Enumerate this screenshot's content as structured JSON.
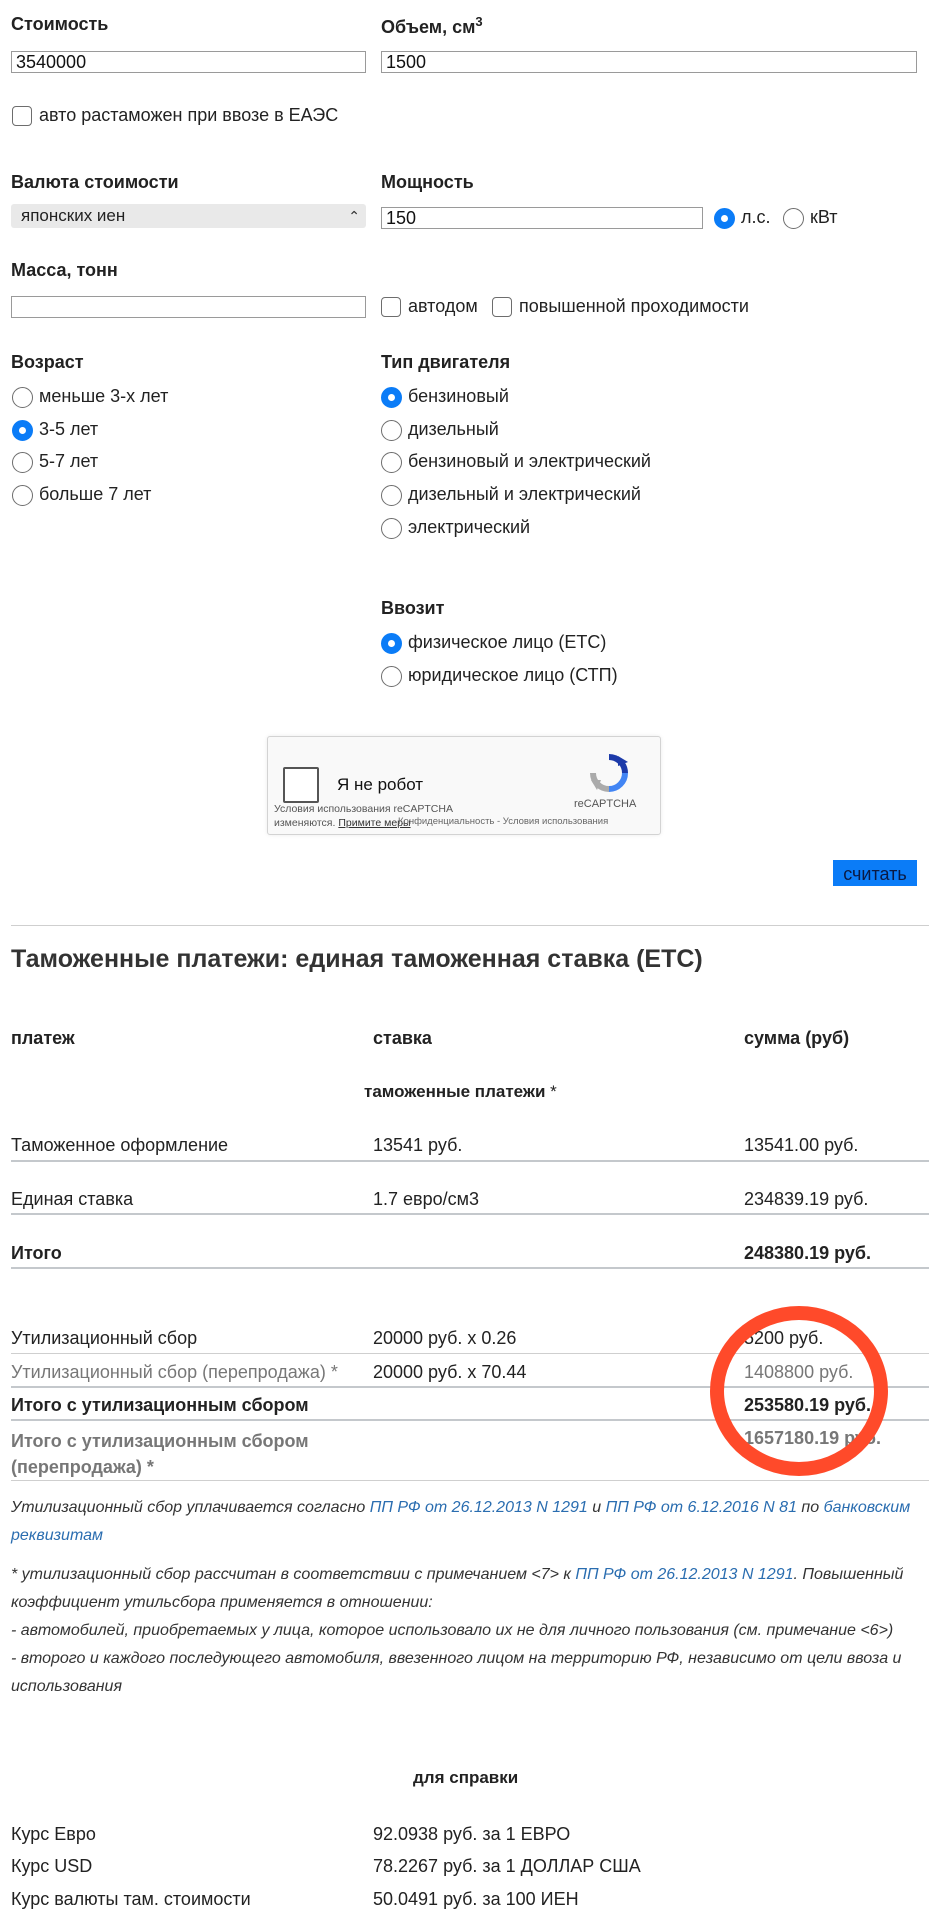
{
  "form": {
    "cost_label": "Стоимость",
    "cost_value": "3540000",
    "volume_label": "Объем, см",
    "volume_sup": "3",
    "volume_value": "1500",
    "eaes_label": "авто растаможен при ввозе в ЕАЭС",
    "currency_label": "Валюта стоимости",
    "currency_selected": "японских иен",
    "power_label": "Мощность",
    "power_value": "150",
    "power_units": [
      "л.с.",
      "кВт"
    ],
    "mass_label": "Масса, тонн",
    "mass_value": "",
    "autodom_label": "автодом",
    "offroad_label": "повышенной проходимости",
    "age_label": "Возраст",
    "age_options": [
      "меньше 3-х лет",
      "3-5 лет",
      "5-7 лет",
      "больше 7 лет"
    ],
    "age_selected_index": 1,
    "engine_label": "Тип двигателя",
    "engine_options": [
      "бензиновый",
      "дизельный",
      "бензиновый и электрический",
      "дизельный и электрический",
      "электрический"
    ],
    "engine_selected_index": 0,
    "importer_label": "Ввозит",
    "importer_options": [
      "физическое лицо (ЕТС)",
      "юридическое лицо (СТП)"
    ],
    "importer_selected_index": 0,
    "calc_button": "считать"
  },
  "captcha": {
    "label": "Я не робот",
    "brand": "reCAPTCHA",
    "notice_line1": "Условия использования reCAPTCHA",
    "notice_line2_a": "изменяются.",
    "notice_line2_link": "Примите меры",
    "footer": "Конфиденциальность - Условия использования"
  },
  "results": {
    "title": "Таможенные платежи: единая таможенная ставка (ЕТС)",
    "col_payment": "платеж",
    "col_rate": "ставка",
    "col_sum": "сумма (руб)",
    "section_customs": "таможенные платежи",
    "star": "*",
    "rows": [
      {
        "name": "Таможенное оформление",
        "rate": "13541 руб.",
        "sum": "13541.00 руб."
      },
      {
        "name": "Единая ставка",
        "rate": "1.7 евро/см3",
        "sum": "234839.19 руб."
      }
    ],
    "total_label": "Итого",
    "total_sum": "248380.19 руб.",
    "util_rows": [
      {
        "name": "Утилизационный сбор",
        "rate": "20000 руб. х 0.26",
        "sum": "5200 руб."
      },
      {
        "name": "Утилизационный сбор (перепродажа) *",
        "rate": "20000 руб. х 70.44",
        "sum": "1408800 руб."
      }
    ],
    "total_util_label": "Итого с утилизационным сбором",
    "total_util_sum": "253580.19 руб.",
    "total_util_resale_label_1": "Итого с утилизационным сбором",
    "total_util_resale_label_2": "(перепродажа) *",
    "total_util_resale_sum": "1657180.19 руб."
  },
  "notes": {
    "util_note_a": "Утилизационный сбор уплачивается согласно ",
    "util_note_link1": "ПП РФ от 26.12.2013 N 1291",
    "util_note_b": " и ",
    "util_note_link2": "ПП РФ от 6.12.2016 N 81",
    "util_note_c": " по ",
    "util_note_link3a": "банковским",
    "util_note_link3b": "реквизитам",
    "star_note_a": "* утилизационный сбор рассчитан в соответствии с примечанием <7> к ",
    "star_note_link": "ПП РФ от 26.12.2013 N 1291",
    "star_note_b": ". Повышенный",
    "star_note_line2": "коэффициент утильсбора применяется в отношении:",
    "star_note_line3": "- автомобилей, приобретаемых у лица, которое использовало их не для личного пользования (см. примечание <6>)",
    "star_note_line4": "- второго и каждого последующего автомобиля, ввезенного лицом на территорию РФ, независимо от цели ввоза и",
    "star_note_line5": "использования"
  },
  "reference": {
    "title": "для справки",
    "rows": [
      {
        "name": "Курс Евро",
        "value": "92.0938 руб. за 1 ЕВРО"
      },
      {
        "name": "Курс USD",
        "value": "78.2267 руб. за 1 ДОЛЛАР США"
      },
      {
        "name": "Курс валюты там. стоимости",
        "value": "50.0491 руб. за 100 ИЕН"
      }
    ]
  },
  "colors": {
    "accent": "#0b7cf7",
    "link": "#2a6db0",
    "highlight_circle": "#ff4a2a"
  }
}
